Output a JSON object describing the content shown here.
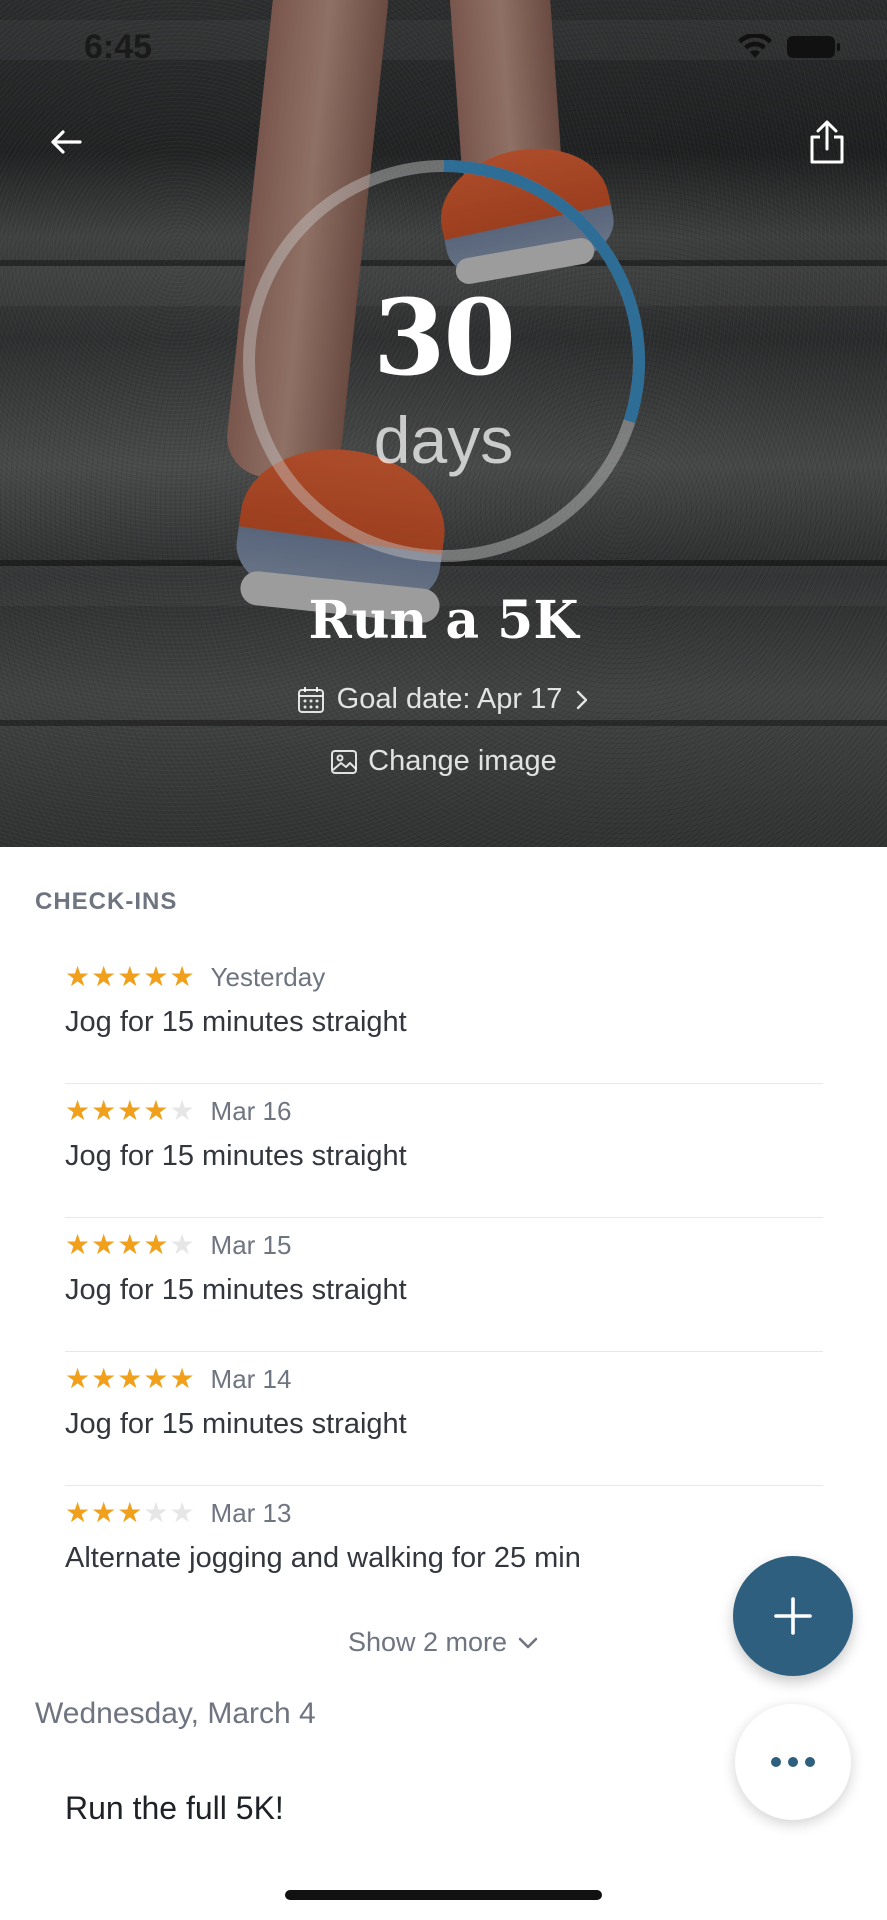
{
  "status_bar": {
    "time": "6:45"
  },
  "hero": {
    "count": "30",
    "unit": "days",
    "progress_fraction": 0.3,
    "title": "Run a 5K",
    "goal_date_label": "Goal date: Apr 17",
    "change_image_label": "Change image"
  },
  "checkins": {
    "header": "CHECK-INS",
    "items": [
      {
        "rating": 5,
        "date": "Yesterday",
        "text": "Jog for 15 minutes straight"
      },
      {
        "rating": 4,
        "date": "Mar 16",
        "text": "Jog for 15 minutes straight"
      },
      {
        "rating": 4,
        "date": "Mar 15",
        "text": "Jog for 15 minutes straight"
      },
      {
        "rating": 5,
        "date": "Mar 14",
        "text": "Jog for 15 minutes straight"
      },
      {
        "rating": 3,
        "date": "Mar 13",
        "text": "Alternate jogging and walking for 25 min"
      }
    ],
    "show_more_label": "Show 2 more"
  },
  "notes": {
    "day_header": "Wednesday, March 4",
    "text": "Run the full 5K!"
  },
  "colors": {
    "accent": "#2e5f7f",
    "star": "#f0a01a",
    "star_off": "#e6e6e6",
    "progress_track": "#8a8d8f"
  },
  "icons": {
    "back": "arrow-left-icon",
    "share": "share-icon",
    "calendar": "calendar-icon",
    "image": "image-icon",
    "add": "plus-icon",
    "more": "ellipsis-icon"
  }
}
